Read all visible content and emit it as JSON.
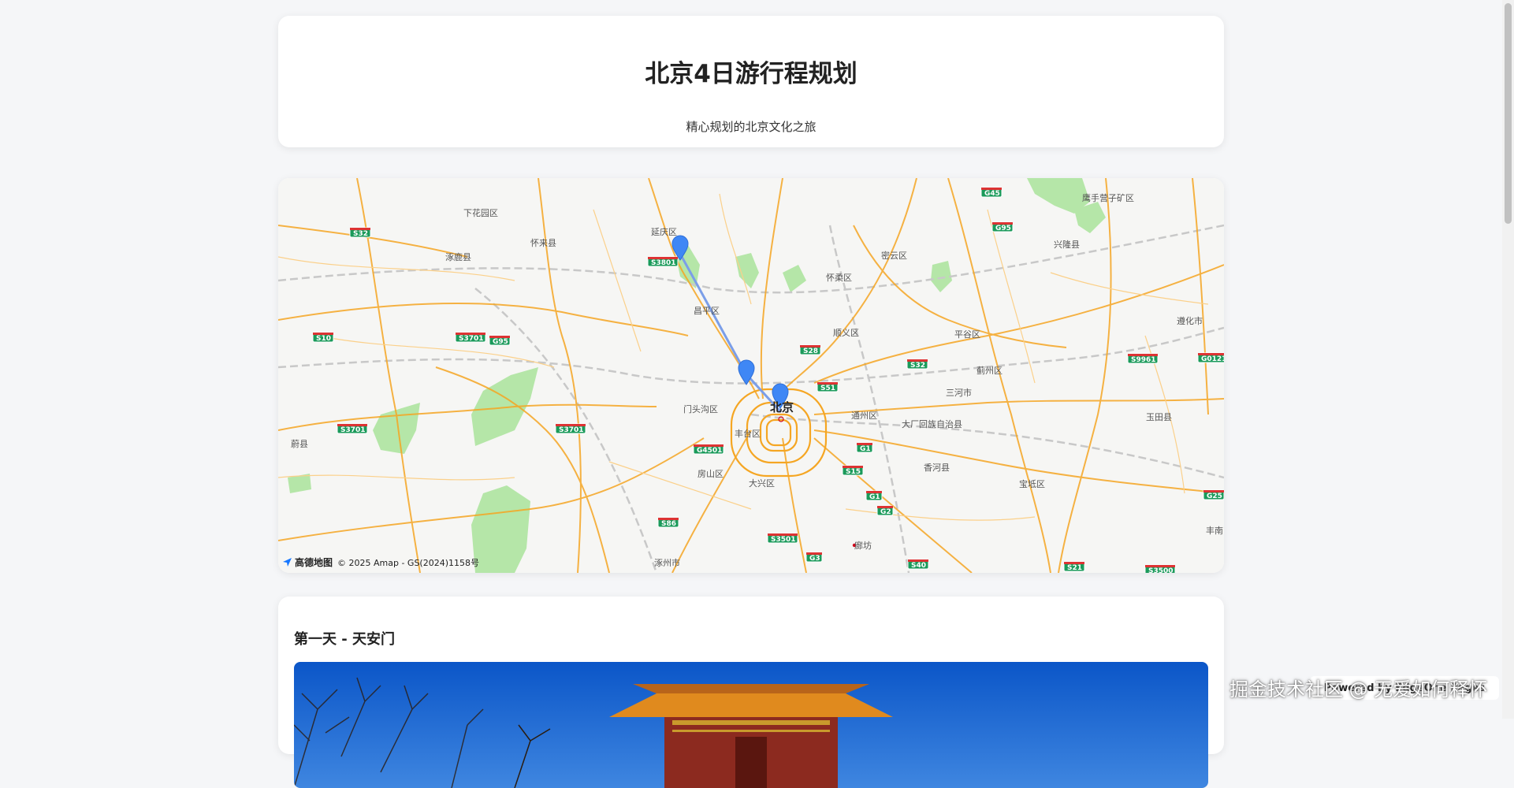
{
  "header": {
    "title": "北京4日游行程规划",
    "subtitle": "精心规划的北京文化之旅"
  },
  "map": {
    "district_labels": [
      "下花园区",
      "延庆区",
      "涿鹿县",
      "怀来县",
      "密云区",
      "怀柔区",
      "兴隆县",
      "鹰手营子矿区",
      "昌平区",
      "顺义区",
      "平谷区",
      "遵化市",
      "蓟州区",
      "门头沟区",
      "三河市",
      "通州区",
      "玉田县",
      "蔚县",
      "丰台区",
      "大厂回族自治县",
      "房山区",
      "大兴区",
      "香河县",
      "宝坻区",
      "涿州市",
      "廊坊",
      "丰南"
    ],
    "city_label": "北京",
    "highway_shields": [
      "G45",
      "S32",
      "G95",
      "S3801",
      "S10",
      "S3701",
      "G95",
      "S28",
      "S32",
      "S9961",
      "G0121",
      "S51",
      "S3701",
      "S3701",
      "G4501",
      "G1",
      "S15",
      "G1",
      "G2",
      "S86",
      "S3501",
      "G3",
      "S40",
      "S21",
      "S3500",
      "G25"
    ],
    "logo_text": "高德地图",
    "copyright": "© 2025 Amap - GS(2024)1158号"
  },
  "day1": {
    "title": "第一天 - 天安门"
  },
  "badge": {
    "text": "Powered by EdgeOne Pages"
  },
  "watermark": {
    "text": "掘金技术社区 @ 无爱如何释怀"
  },
  "colors": {
    "road": "#f5a623",
    "marker": "#3f87f5",
    "route": "#7b9ee8",
    "green": "#b5e6a8"
  }
}
